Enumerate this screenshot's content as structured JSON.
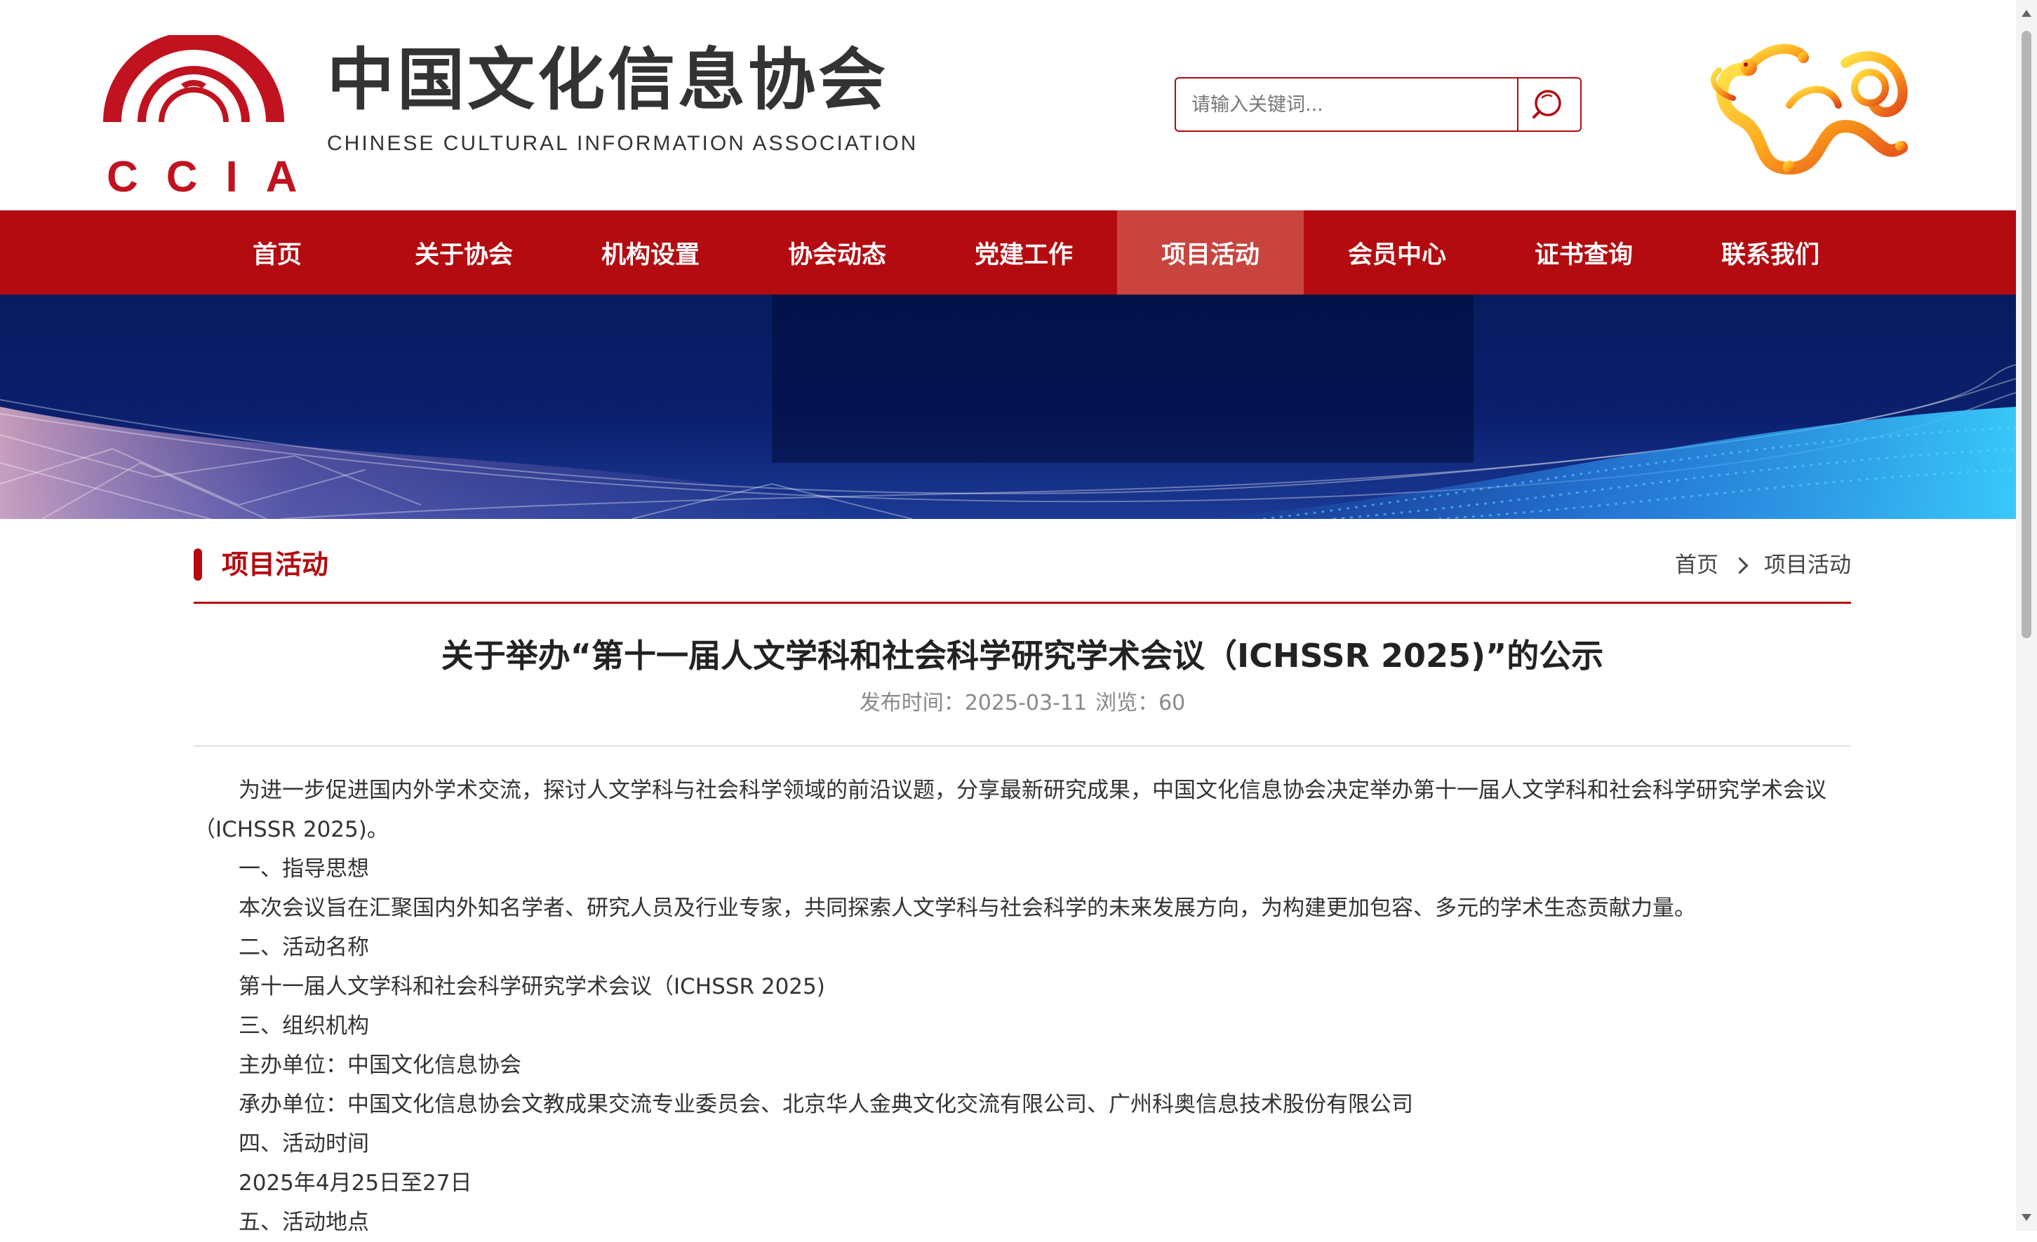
{
  "header": {
    "logo_letters": "CCIA",
    "site_title": "中国文化信息协会",
    "site_subtitle": "CHINESE CULTURAL INFORMATION ASSOCIATION",
    "search_placeholder": "请输入关键词..."
  },
  "nav": {
    "items": [
      {
        "label": "首页"
      },
      {
        "label": "关于协会"
      },
      {
        "label": "机构设置"
      },
      {
        "label": "协会动态"
      },
      {
        "label": "党建工作"
      },
      {
        "label": "项目活动",
        "active": true
      },
      {
        "label": "会员中心"
      },
      {
        "label": "证书查询"
      },
      {
        "label": "联系我们"
      }
    ]
  },
  "section": {
    "title": "项目活动",
    "breadcrumb": [
      "首页",
      "项目活动"
    ]
  },
  "article": {
    "title": "关于举办“第十一届人文学科和社会科学研究学术会议（ICHSSR 2025)”的公示",
    "publish_label": "发布时间：",
    "publish_date": "2025-03-11",
    "views_label": "浏览：",
    "views": "60",
    "paragraphs": [
      "为进一步促进国内外学术交流，探讨人文学科与社会科学领域的前沿议题，分享最新研究成果，中国文化信息协会决定举办第十一届人文学科和社会科学研究学术会议（ICHSSR 2025)。",
      "一、指导思想",
      "本次会议旨在汇聚国内外知名学者、研究人员及行业专家，共同探索人文学科与社会科学的未来发展方向，为构建更加包容、多元的学术生态贡献力量。",
      "二、活动名称",
      "第十一届人文学科和社会科学研究学术会议（ICHSSR 2025)",
      "三、组织机构",
      "主办单位：中国文化信息协会",
      "承办单位：中国文化信息协会文教成果交流专业委员会、北京华人金典文化交流有限公司、广州科奥信息技术股份有限公司",
      "四、活动时间",
      "2025年4月25日至27日",
      "五、活动地点"
    ]
  },
  "colors": {
    "brand_red": "#b30b10",
    "nav_active": "#c9443f"
  },
  "icons": {
    "search": "search-icon",
    "breadcrumb_separator": "chevron-right-icon"
  }
}
